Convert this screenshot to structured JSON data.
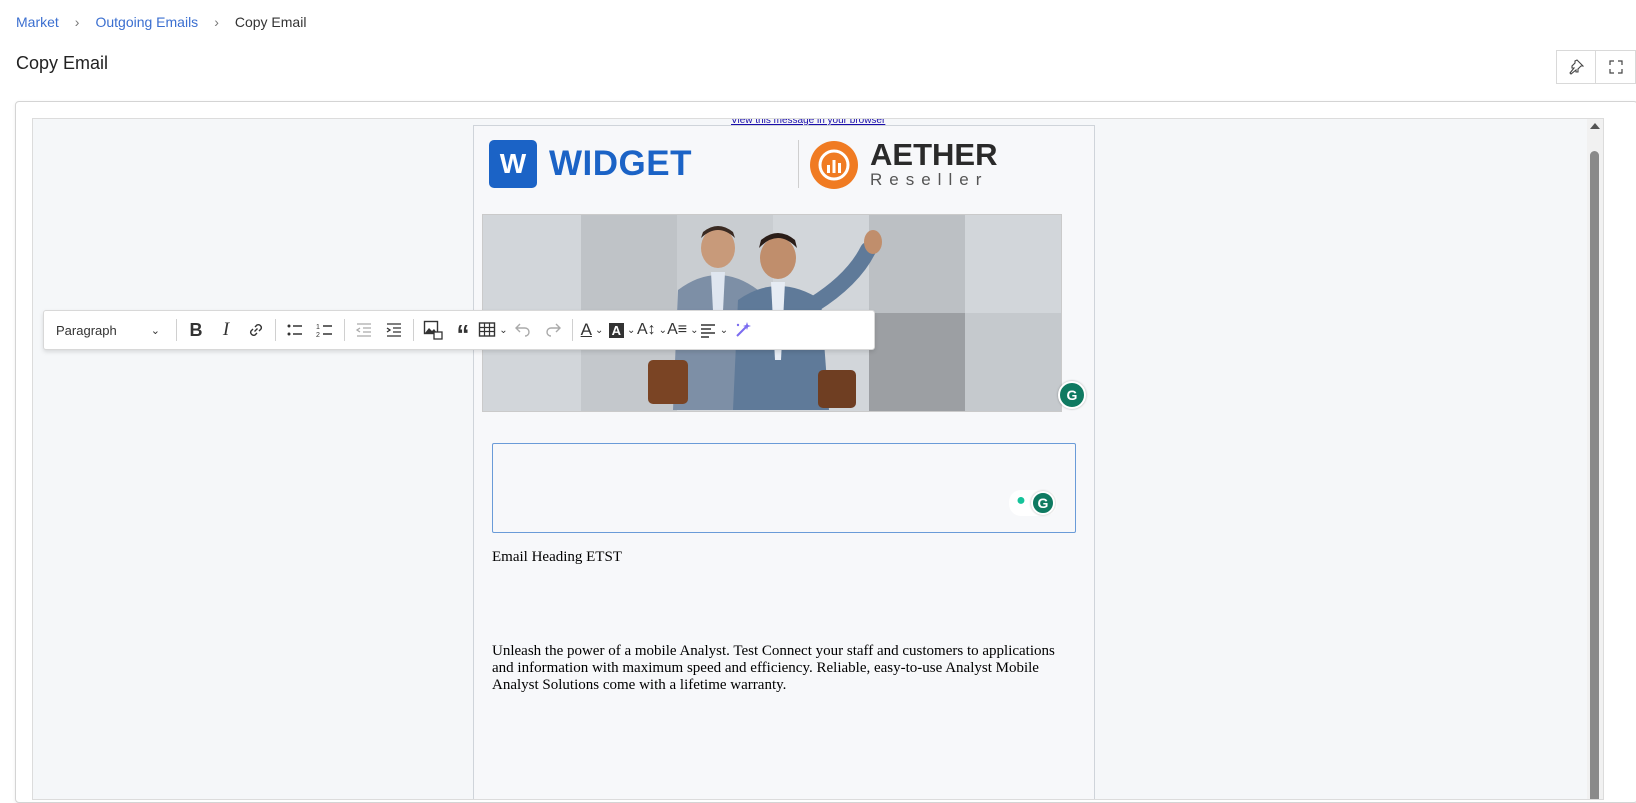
{
  "breadcrumb": {
    "items": [
      "Market",
      "Outgoing Emails"
    ],
    "current": "Copy Email"
  },
  "page": {
    "title": "Copy Email"
  },
  "top_actions": {
    "pin_icon": "pin-icon",
    "fullscreen_icon": "fullscreen-icon"
  },
  "email": {
    "view_link": "View this message in your browser",
    "logo_widget": {
      "letter": "W",
      "text": "WIDGET"
    },
    "logo_aether": {
      "name": "AETHER",
      "sub": "Reseller"
    },
    "heading": "Email Heading ETST",
    "body": "Unleash the power of a mobile Analyst. Test Connect your staff and customers to applications and information with maximum speed and efficiency. Reliable, easy-to-use Analyst Mobile Analyst Solutions come with a lifetime warranty."
  },
  "toolbar": {
    "paragraph_label": "Paragraph",
    "buttons": [
      "bold-icon",
      "italic-icon",
      "link-icon",
      "bulleted-list-icon",
      "numbered-list-icon",
      "outdent-icon",
      "indent-icon",
      "insert-image-icon",
      "blockquote-icon",
      "table-icon",
      "undo-icon",
      "redo-icon",
      "font-color-icon",
      "highlight-icon",
      "font-size-icon",
      "font-family-icon",
      "align-icon",
      "ai-assistant-icon"
    ]
  },
  "colors": {
    "link": "#3b6fd0",
    "widget_blue": "#1b63c6",
    "aether_orange": "#f07b22",
    "grammarly_green": "#15c39a"
  }
}
